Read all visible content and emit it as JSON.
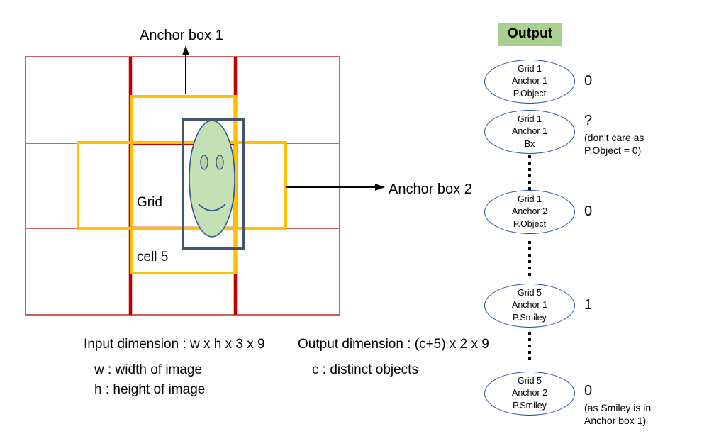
{
  "diagram": {
    "labels": {
      "anchor_box_1": "Anchor box 1",
      "anchor_box_2": "Anchor box 2",
      "grid_cell_line1": "Grid",
      "grid_cell_line2": "cell 5"
    },
    "colors": {
      "grid_line": "#c0504d",
      "highlight_cell": "#c00000",
      "anchor_box": "#ffc000",
      "object_box": "#44546a",
      "smiley_fill": "#c5e0b4",
      "smiley_stroke": "#2e5496",
      "badge_bg": "#a9d08e",
      "node_stroke": "#2e5496"
    },
    "grid": {
      "rows": 3,
      "cols": 3,
      "highlighted_cell_index": 5
    }
  },
  "captions": {
    "input_dimension": "Input dimension : w x h x 3 x 9",
    "w_meaning": "w : width of image",
    "h_meaning": "h : height of image",
    "output_dimension": "Output dimension : (c+5) x 2 x 9",
    "c_meaning": "c : distinct objects"
  },
  "output": {
    "title": "Output",
    "nodes": [
      {
        "line1": "Grid 1",
        "line2": "Anchor 1",
        "line3": "P.Object",
        "value": "0",
        "note": ""
      },
      {
        "line1": "Grid 1",
        "line2": "Anchor 1",
        "line3": "Bx",
        "value": "?",
        "note": "(don't care as\nP.Object = 0)"
      },
      {
        "line1": "Grid 1",
        "line2": "Anchor 2",
        "line3": "P.Object",
        "value": "0",
        "note": ""
      },
      {
        "line1": "Grid 5",
        "line2": "Anchor 1",
        "line3": "P.Smiley",
        "value": "1",
        "note": ""
      },
      {
        "line1": "Grid 5",
        "line2": "Anchor 2",
        "line3": "P.Smiley",
        "value": "0",
        "note": "(as Smiley is in\nAnchor box 1)"
      }
    ]
  }
}
